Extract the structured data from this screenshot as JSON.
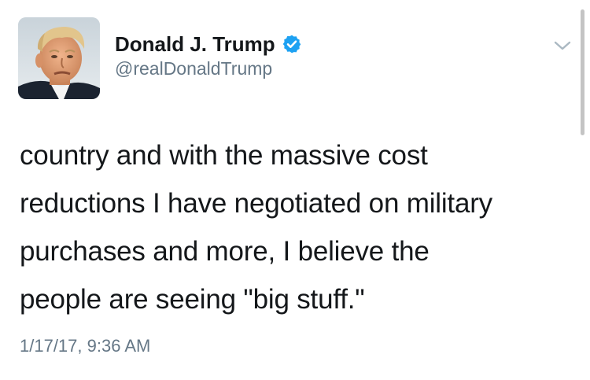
{
  "tweet": {
    "author": {
      "display_name": "Donald J. Trump",
      "handle": "@realDonaldTrump",
      "verified": true
    },
    "text": "country and with the massive cost\nreductions I have negotiated on military\npurchases and more, I believe the\npeople are seeing \"big stuff.\"",
    "timestamp": "1/17/17, 9:36 AM"
  },
  "icons": {
    "verified": "verified-badge-icon",
    "menu": "chevron-down-icon"
  },
  "colors": {
    "verified_blue": "#1da1f2",
    "secondary_text": "#657786",
    "primary_text": "#14171a"
  }
}
